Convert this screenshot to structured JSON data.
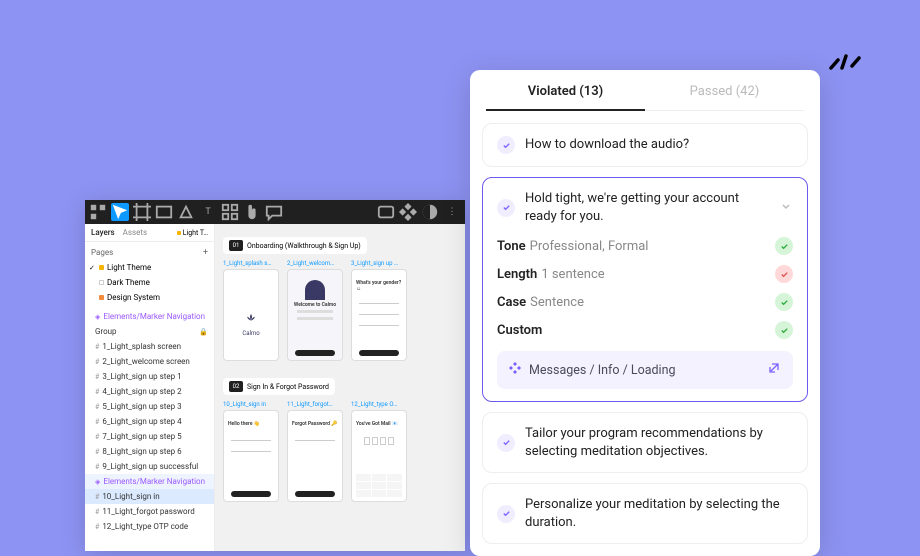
{
  "accent": {
    "purple": "#6d5aee",
    "bg": "#8d93f2"
  },
  "editor": {
    "tabs": {
      "layers": "Layers",
      "assets": "Assets",
      "file": "Light T…"
    },
    "pages_label": "Pages",
    "pages": [
      {
        "name": "Light Theme",
        "checked": true,
        "dot": "y"
      },
      {
        "name": "Dark Theme",
        "dot": "o"
      },
      {
        "name": "Design System",
        "dot": "n"
      }
    ],
    "group_purple": "Elements/Marker Navigation",
    "group_label": "Group",
    "layers": [
      {
        "name": "1_Light_splash screen"
      },
      {
        "name": "2_Light_welcome screen"
      },
      {
        "name": "3_Light_sign up step 1"
      },
      {
        "name": "4_Light_sign up step 2"
      },
      {
        "name": "5_Light_sign up step 3"
      },
      {
        "name": "6_Light_sign up step 4"
      },
      {
        "name": "7_Light_sign up step 5"
      },
      {
        "name": "8_Light_sign up step 6"
      },
      {
        "name": "9_Light_sign up successful"
      },
      {
        "name": "Elements/Marker Navigation",
        "purple": true
      },
      {
        "name": "10_Light_sign in",
        "selected": true
      },
      {
        "name": "11_Light_forgot password"
      },
      {
        "name": "12_Light_type OTP code"
      }
    ],
    "sections": {
      "s1": {
        "num": "01",
        "label": "Onboarding (Walkthrough & Sign Up)"
      },
      "s2": {
        "num": "02",
        "label": "Sign In & Forgot Password"
      }
    },
    "frames_r1": [
      {
        "name": "1_Light_splash s…",
        "variant": "splash",
        "app": "Calmo"
      },
      {
        "name": "2_Light_welcom…",
        "variant": "welcome",
        "title": "Welcome to Calmo"
      },
      {
        "name": "3_Light_sign up …",
        "variant": "form",
        "title": "What's your gender? ☺"
      }
    ],
    "frames_r2": [
      {
        "name": "10_Light_sign in",
        "variant": "signin",
        "title": "Hello there 👋"
      },
      {
        "name": "11_Light_forgot…",
        "variant": "forgot",
        "title": "Forgot Password 🔑"
      },
      {
        "name": "12_Light_type O…",
        "variant": "otp",
        "title": "You've Got Mail 📧"
      }
    ]
  },
  "results": {
    "tabs": {
      "violated": "Violated (13)",
      "passed": "Passed (42)"
    },
    "items": {
      "r1": "How to download the audio?",
      "r2": "Hold tight, we're getting your account ready for you.",
      "r3": "Tailor your program recommendations by selecting meditation objectives.",
      "r4": "Personalize your meditation by selecting the duration."
    },
    "checks": {
      "tone": {
        "label": "Tone",
        "val": "Professional, Formal",
        "ok": true
      },
      "length": {
        "label": "Length",
        "val": "1 sentence",
        "ok": false
      },
      "case": {
        "label": "Case",
        "val": "Sentence",
        "ok": true
      },
      "custom": {
        "label": "Custom",
        "val": "",
        "ok": true
      }
    },
    "component": "Messages / Info / Loading"
  }
}
